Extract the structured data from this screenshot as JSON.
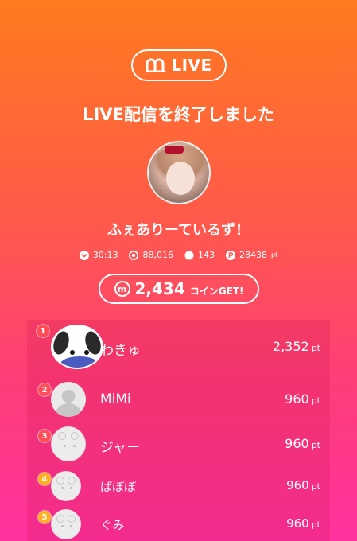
{
  "header": {
    "logo_text": "LIVE",
    "title": "LIVE配信を終了しました"
  },
  "streamer": {
    "name": "ふぇありーているず！"
  },
  "stats": {
    "duration": "30:13",
    "viewers": "88,016",
    "comments": "143",
    "points": "28438",
    "points_unit": "pt"
  },
  "coins": {
    "icon_letter": "m",
    "amount": "2,434",
    "suffix": "コインGET!"
  },
  "ranking": [
    {
      "rank": "1",
      "name": "わきゅ",
      "points": "2,352",
      "unit": "pt"
    },
    {
      "rank": "2",
      "name": "MiMi",
      "points": "960",
      "unit": "pt"
    },
    {
      "rank": "3",
      "name": "ジャー",
      "points": "960",
      "unit": "pt"
    },
    {
      "rank": "4",
      "name": "ぱぽぽ",
      "points": "960",
      "unit": "pt"
    },
    {
      "rank": "5",
      "name": "ぐみ",
      "points": "960",
      "unit": "pt"
    }
  ],
  "colors": {
    "gradient_top": "#ff7a1e",
    "gradient_bottom": "#ff33a0",
    "rank_badge": "#ff4e57",
    "rank_badge_gold": "#ffb01a"
  }
}
